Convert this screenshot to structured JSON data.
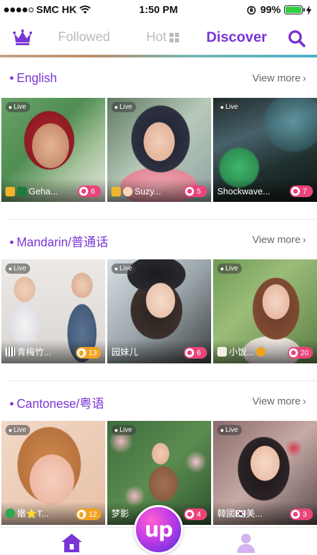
{
  "status_bar": {
    "carrier": "SMC HK",
    "time": "1:50 PM",
    "battery": "99%",
    "battery_level": 0.99,
    "signal_bars_filled": 4
  },
  "nav": {
    "tabs": [
      {
        "label": "Followed",
        "active": false
      },
      {
        "label": "Hot",
        "active": false
      },
      {
        "label": "Discover",
        "active": true
      }
    ],
    "accent_color": "#7a35d6"
  },
  "sections": [
    {
      "title": "English",
      "view_more": "View more",
      "cards": [
        {
          "live": "Live",
          "name": "Geha...",
          "count": "6",
          "pill": "pink"
        },
        {
          "live": "Live",
          "name": "Suzy...",
          "count": "5",
          "pill": "pink"
        },
        {
          "live": "Live",
          "name": "Shockwave...",
          "count": "7",
          "pill": "pink"
        }
      ]
    },
    {
      "title": "Mandarin/普通话",
      "view_more": "View more",
      "cards": [
        {
          "live": "Live",
          "name": "青梅竹...",
          "count": "13",
          "pill": "orange"
        },
        {
          "live": "Live",
          "name": "园妹儿",
          "count": "6",
          "pill": "pink"
        },
        {
          "live": "Live",
          "name": "小饭...",
          "count": "20",
          "pill": "pink"
        }
      ]
    },
    {
      "title": "Cantonese/粤语",
      "view_more": "View more",
      "cards": [
        {
          "live": "Live",
          "name": "嫩⭐T...",
          "count": "12",
          "pill": "orange"
        },
        {
          "live": "Live",
          "name": "梦影",
          "count": "4",
          "pill": "pink"
        },
        {
          "live": "Live",
          "name": "韓國🇰🇷美...",
          "count": "3",
          "pill": "pink"
        }
      ]
    }
  ],
  "center_button": {
    "label": "up"
  },
  "colors": {
    "pink_pill": "#e9457a",
    "orange_pill": "#f0a321",
    "tab_icon": "#7a35d6",
    "tab_icon_inactive": "#d3b3f0"
  }
}
